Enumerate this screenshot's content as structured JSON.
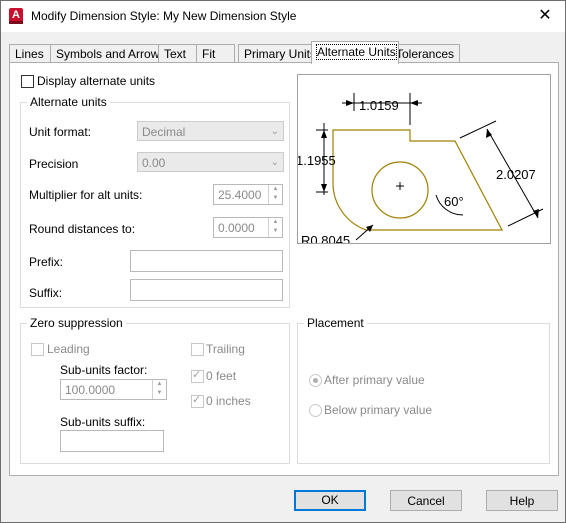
{
  "window": {
    "title": "Modify Dimension Style: My New Dimension Style",
    "app_icon_letter": "A",
    "close_glyph": "✕"
  },
  "tabs": [
    {
      "label": "Lines"
    },
    {
      "label": "Symbols and Arrows"
    },
    {
      "label": "Text"
    },
    {
      "label": "Fit"
    },
    {
      "label": "Primary Units"
    },
    {
      "label": "Alternate Units",
      "active": true
    },
    {
      "label": "Tolerances"
    }
  ],
  "display_alternate": {
    "label": "Display alternate units",
    "checked": false
  },
  "alternate_units": {
    "group_label": "Alternate units",
    "unit_format_label": "Unit format:",
    "unit_format_value": "Decimal",
    "precision_label": "Precision",
    "precision_value": "0.00",
    "multiplier_label": "Multiplier for alt units:",
    "multiplier_value": "25.4000",
    "round_label": "Round distances  to:",
    "round_value": "0.0000",
    "prefix_label": "Prefix:",
    "prefix_value": "",
    "suffix_label": "Suffix:",
    "suffix_value": ""
  },
  "preview": {
    "dim_top": "1.0159",
    "dim_left": "1.1955",
    "dim_right": "2.0207",
    "angle": "60°",
    "radius": "R0.8045"
  },
  "zero_suppression": {
    "group_label": "Zero suppression",
    "leading_label": "Leading",
    "trailing_label": "Trailing",
    "subunits_factor_label": "Sub-units factor:",
    "subunits_factor_value": "100.0000",
    "zero_feet_label": "0 feet",
    "zero_inches_label": "0 inches",
    "subunits_suffix_label": "Sub-units suffix:",
    "subunits_suffix_value": ""
  },
  "placement": {
    "group_label": "Placement",
    "after_label": "After primary value",
    "below_label": "Below primary value",
    "selected": "After primary value"
  },
  "buttons": {
    "ok": "OK",
    "cancel": "Cancel",
    "help": "Help"
  },
  "colors": {
    "accent": "#0078d7",
    "app_icon": "#c8102e",
    "preview_outline": "#a08000"
  }
}
